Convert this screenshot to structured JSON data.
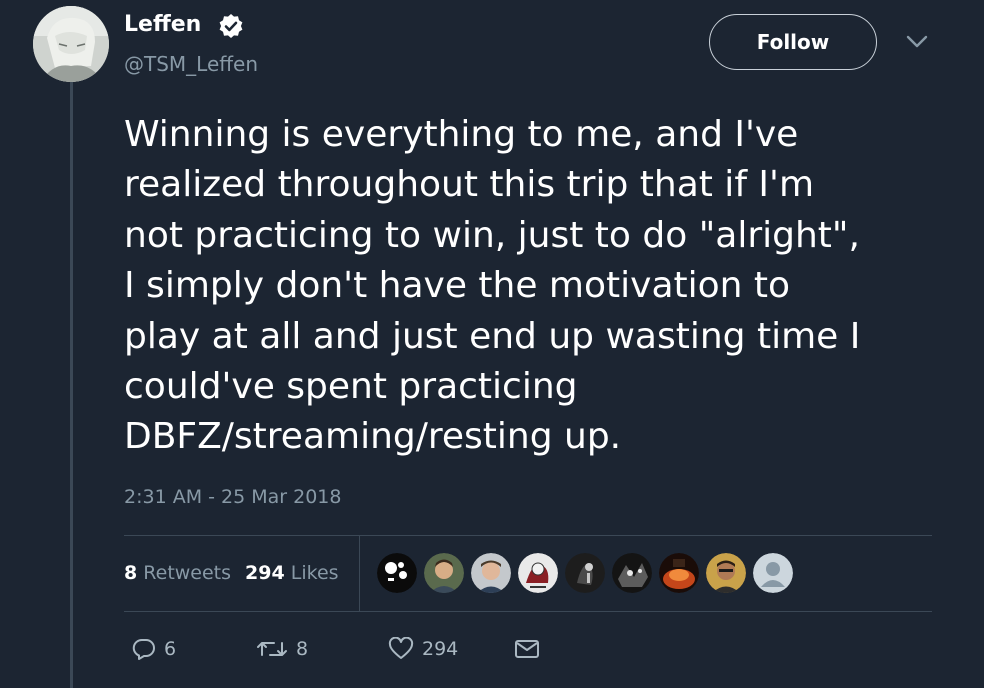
{
  "author": {
    "display_name": "Leffen",
    "handle": "@TSM_Leffen",
    "verified": true
  },
  "header": {
    "follow_label": "Follow"
  },
  "tweet": {
    "text": "Winning is everything to me, and I've\nrealized throughout this trip that if I'm\nnot practicing to win, just to do \"alright\",\nI simply don't have the motivation to\nplay at all and just end up wasting time I\ncould've spent practicing\nDBFZ/streaming/resting up.",
    "timestamp": "2:31 AM - 25 Mar 2018"
  },
  "stats": {
    "retweets_count": "8",
    "retweets_label": "Retweets",
    "likes_count": "294",
    "likes_label": "Likes"
  },
  "liker_avatars": [
    "liker-avatar-1",
    "liker-avatar-2",
    "liker-avatar-3",
    "liker-avatar-4",
    "liker-avatar-5",
    "liker-avatar-6",
    "liker-avatar-7",
    "liker-avatar-8",
    "liker-avatar-9"
  ],
  "actions": {
    "reply_count": "6",
    "retweet_count": "8",
    "like_count": "294"
  },
  "colors": {
    "background": "#1c2532",
    "muted_text": "#8899a6",
    "divider": "#3b4856",
    "text": "#ffffff"
  }
}
